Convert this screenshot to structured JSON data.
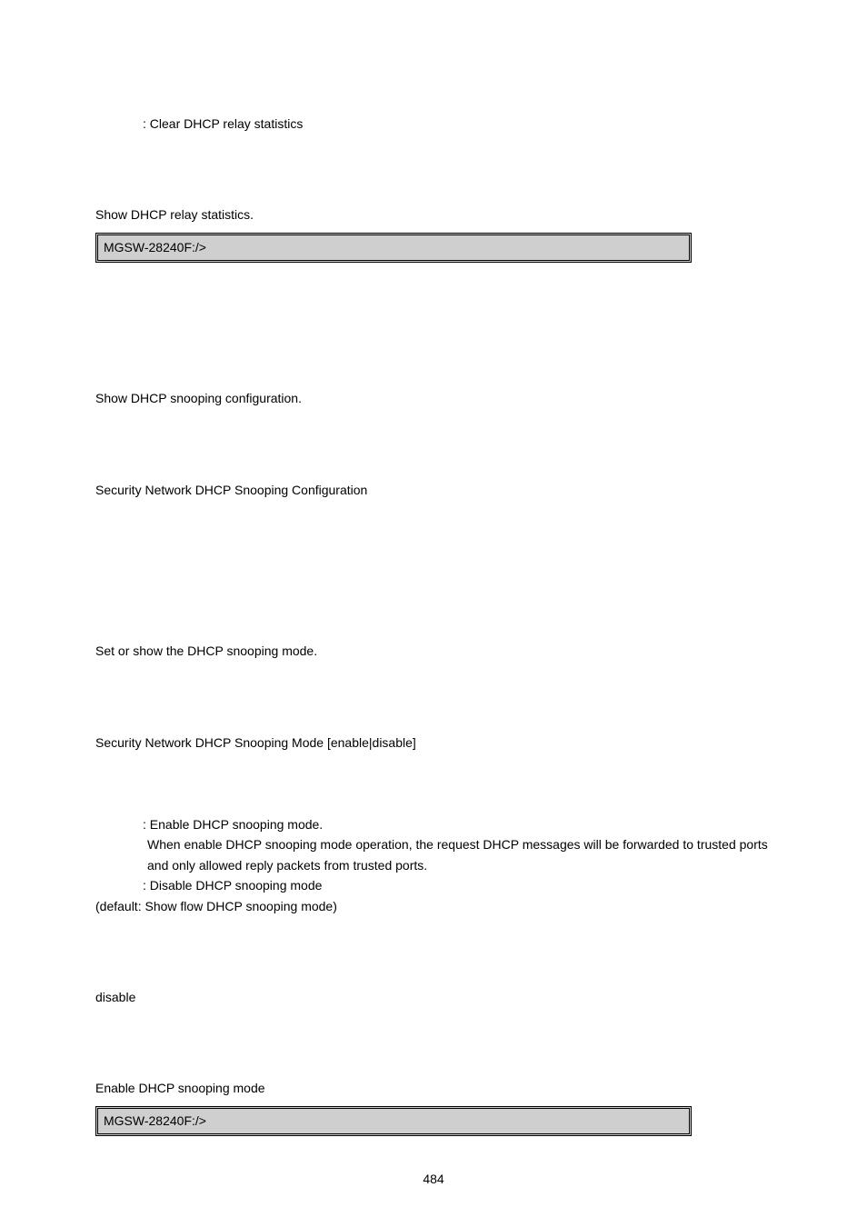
{
  "param1": {
    "desc": ": Clear DHCP relay statistics"
  },
  "example1": {
    "caption": "Show DHCP relay statistics.",
    "prompt": "MGSW-28240F:/>"
  },
  "snoop_conf": {
    "desc": "Show DHCP snooping configuration.",
    "syntax": "Security Network DHCP Snooping Configuration"
  },
  "snoop_mode": {
    "desc": "Set or show the DHCP snooping mode.",
    "syntax": "Security Network DHCP Snooping Mode [enable|disable]",
    "params": {
      "enable": ": Enable DHCP snooping mode.",
      "enable_detail1": " When enable DHCP snooping mode operation, the request DHCP messages will be forwarded to trusted ports",
      "enable_detail2": " and only allowed reply packets from trusted ports.",
      "disable": ": Disable DHCP snooping mode"
    },
    "default": "(default: Show flow DHCP snooping mode)",
    "default_value": "disable"
  },
  "example2": {
    "caption": "Enable DHCP snooping mode",
    "prompt": "MGSW-28240F:/>"
  },
  "page_number": "484"
}
